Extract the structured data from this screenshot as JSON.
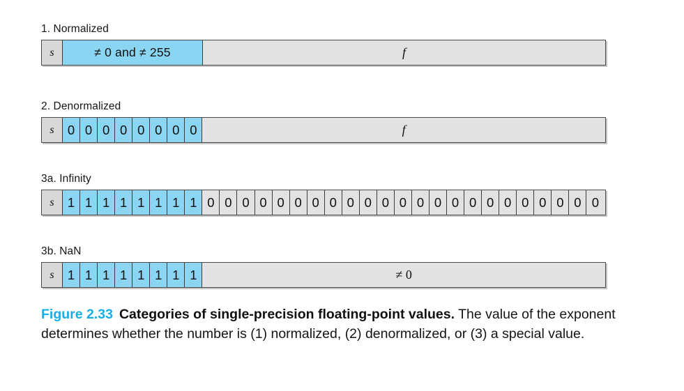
{
  "figure": {
    "caption": {
      "number": "Figure 2.33",
      "title": "Categories of single-precision floating-point values.",
      "body": "The value of the exponent determines whether the number is (1) normalized, (2) denormalized, or (3) a special value.",
      "number_color": "#16AEE8"
    },
    "colors": {
      "highlight_cyan": "#8AD5F2",
      "cell_gray": "#E2E2E2",
      "sign_gray": "#D8D8D8",
      "border": "#3C3C3C"
    },
    "groups": [
      {
        "id": "normalized",
        "label": "1. Normalized",
        "sign_label": "s",
        "exponent_label": "≠ 0 and ≠ 255",
        "fraction_label": "f"
      },
      {
        "id": "denormalized",
        "label": "2. Denormalized",
        "sign_label": "s",
        "exponent_bits": [
          "0",
          "0",
          "0",
          "0",
          "0",
          "0",
          "0",
          "0"
        ],
        "fraction_label": "f"
      },
      {
        "id": "infinity",
        "label": "3a. Infinity",
        "sign_label": "s",
        "exponent_bits": [
          "1",
          "1",
          "1",
          "1",
          "1",
          "1",
          "1",
          "1"
        ],
        "fraction_bits": [
          "0",
          "0",
          "0",
          "0",
          "0",
          "0",
          "0",
          "0",
          "0",
          "0",
          "0",
          "0",
          "0",
          "0",
          "0",
          "0",
          "0",
          "0",
          "0",
          "0",
          "0",
          "0",
          "0"
        ]
      },
      {
        "id": "nan",
        "label": "3b. NaN",
        "sign_label": "s",
        "exponent_bits": [
          "1",
          "1",
          "1",
          "1",
          "1",
          "1",
          "1",
          "1"
        ],
        "fraction_label": "≠ 0"
      }
    ]
  }
}
